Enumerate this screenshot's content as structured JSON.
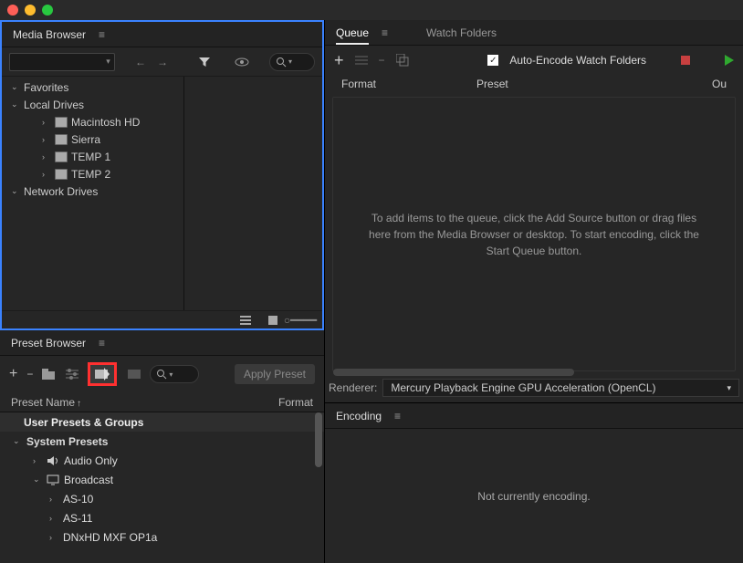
{
  "mediaBrowser": {
    "title": "Media Browser",
    "tree": {
      "favorites": "Favorites",
      "localDrives": "Local Drives",
      "drives": [
        "Macintosh HD",
        "Sierra",
        "TEMP 1",
        "TEMP 2"
      ],
      "networkDrives": "Network Drives"
    }
  },
  "presetBrowser": {
    "title": "Preset Browser",
    "applyLabel": "Apply Preset",
    "col1": "Preset Name",
    "col2": "Format",
    "userPresets": "User Presets & Groups",
    "systemPresets": "System Presets",
    "items": {
      "audioOnly": "Audio Only",
      "broadcast": "Broadcast",
      "as10": "AS-10",
      "as11": "AS-11",
      "dnx": "DNxHD MXF OP1a"
    }
  },
  "queue": {
    "tabQueue": "Queue",
    "tabWatch": "Watch Folders",
    "autoEncode": "Auto-Encode Watch Folders",
    "colFormat": "Format",
    "colPreset": "Preset",
    "colOutput": "Ou",
    "emptyText": "To add items to the queue, click the Add Source button or drag files here from the Media Browser or desktop.  To start encoding, click the Start Queue button.",
    "rendererLabel": "Renderer:",
    "rendererValue": "Mercury Playback Engine GPU Acceleration (OpenCL)"
  },
  "encoding": {
    "title": "Encoding",
    "status": "Not currently encoding."
  }
}
